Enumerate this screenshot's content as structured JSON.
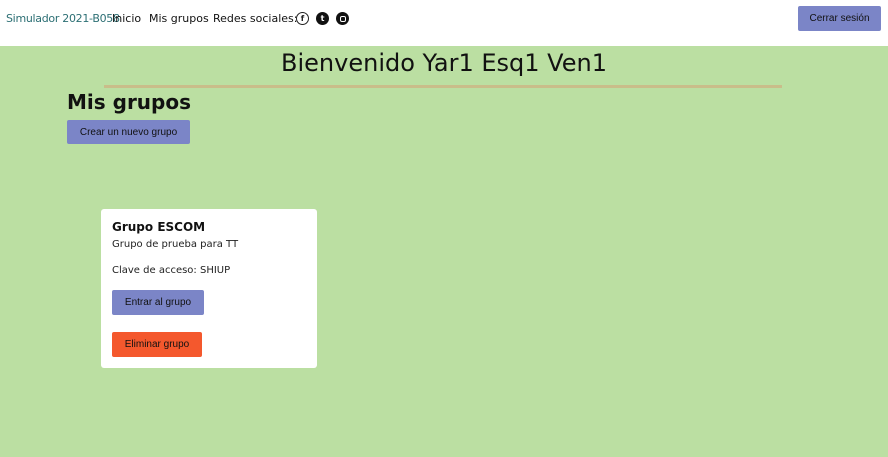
{
  "navbar": {
    "brand": "Simulador 2021-B058",
    "links": [
      "Inicio",
      "Mis grupos"
    ],
    "social_label": "Redes sociales:",
    "social_icons": [
      "facebook-icon",
      "twitter-icon",
      "instagram-icon"
    ],
    "social_glyphs": {
      "facebook": "f",
      "twitter": "t"
    },
    "logout_label": "Cerrar sesión"
  },
  "main": {
    "welcome": "Bienvenido Yar1 Esq1 Ven1",
    "section_title": "Mis grupos",
    "create_label": "Crear un nuevo grupo"
  },
  "groups": [
    {
      "name": "Grupo ESCOM",
      "description": "Grupo de prueba para TT",
      "access_key": "Clave de acceso: SHIUP",
      "enter_label": "Entrar al grupo",
      "delete_label": "Eliminar grupo"
    }
  ],
  "colors": {
    "background": "#bbdfa2",
    "primary_button": "#7b85c7",
    "danger_button": "#f4582d",
    "divider": "#c9bd8a",
    "brand": "#2c6f74"
  }
}
